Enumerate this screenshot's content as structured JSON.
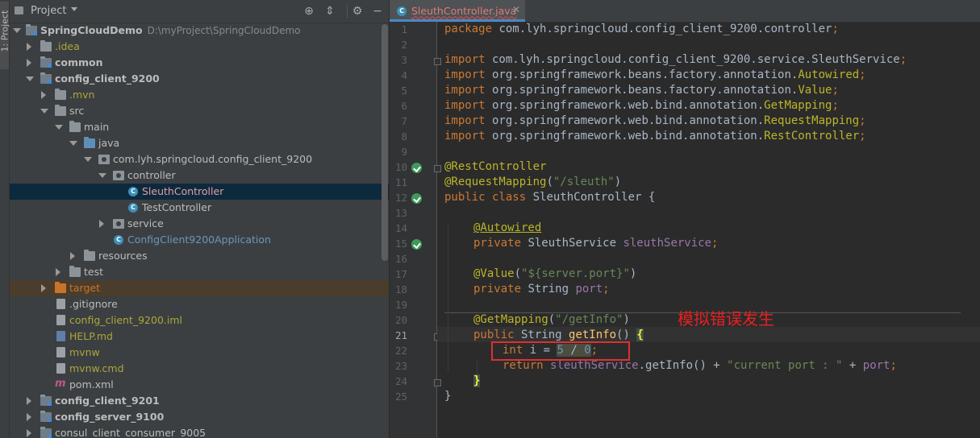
{
  "sidebar_stripe": {
    "label": "1: Project"
  },
  "project_panel": {
    "title": "Project",
    "tree": [
      {
        "label": "SpringCloudDemo",
        "path": "D:\\myProject\\SpringCloudDemo"
      },
      {
        "label": ".idea"
      },
      {
        "label": "common"
      },
      {
        "label": "config_client_9200"
      },
      {
        "label": ".mvn"
      },
      {
        "label": "src"
      },
      {
        "label": "main"
      },
      {
        "label": "java"
      },
      {
        "label": "com.lyh.springcloud.config_client_9200"
      },
      {
        "label": "controller"
      },
      {
        "label": "SleuthController"
      },
      {
        "label": "TestController"
      },
      {
        "label": "service"
      },
      {
        "label": "ConfigClient9200Application"
      },
      {
        "label": "resources"
      },
      {
        "label": "test"
      },
      {
        "label": "target"
      },
      {
        "label": ".gitignore"
      },
      {
        "label": "config_client_9200.iml"
      },
      {
        "label": "HELP.md"
      },
      {
        "label": "mvnw"
      },
      {
        "label": "mvnw.cmd"
      },
      {
        "label": "pom.xml"
      },
      {
        "label": "config_client_9201"
      },
      {
        "label": "config_server_9100"
      },
      {
        "label": "consul_client_consumer_9005"
      }
    ]
  },
  "editor": {
    "tab": {
      "label": "SleuthController.java",
      "icon_letter": "C"
    },
    "line_numbers": [
      "1",
      "2",
      "3",
      "4",
      "5",
      "6",
      "7",
      "8",
      "9",
      "10",
      "11",
      "12",
      "13",
      "14",
      "15",
      "16",
      "17",
      "18",
      "19",
      "20",
      "21",
      "22",
      "23",
      "24",
      "25"
    ],
    "tokens": {
      "l1": [
        "package",
        " com.lyh.springcloud.config_client_9200.controller",
        ";"
      ],
      "l3": [
        "import",
        " com.lyh.springcloud.config_client_9200.service.SleuthService",
        ";"
      ],
      "l4": [
        "import",
        " org.springframework.beans.factory.annotation.",
        "Autowired",
        ";"
      ],
      "l5": [
        "import",
        " org.springframework.beans.factory.annotation.",
        "Value",
        ";"
      ],
      "l6": [
        "import",
        " org.springframework.web.bind.annotation.",
        "GetMapping",
        ";"
      ],
      "l7": [
        "import",
        " org.springframework.web.bind.annotation.",
        "RequestMapping",
        ";"
      ],
      "l8": [
        "import",
        " org.springframework.web.bind.annotation.",
        "RestController",
        ";"
      ],
      "l10": [
        "@RestController"
      ],
      "l11": [
        "@RequestMapping",
        "(",
        "\"/sleuth\"",
        ")"
      ],
      "l12": [
        "public class",
        " SleuthController {"
      ],
      "l14": [
        "@Autowired"
      ],
      "l15": [
        "private",
        " SleuthService ",
        "sleuthService",
        ";"
      ],
      "l17": [
        "@Value",
        "(",
        "\"${server.port}\"",
        ")"
      ],
      "l18": [
        "private",
        " String ",
        "port",
        ";"
      ],
      "l20": [
        "@GetMapping",
        "(",
        "\"/getInfo\"",
        ")"
      ],
      "l21": [
        "public",
        " String ",
        "getInfo",
        "() ",
        "{"
      ],
      "l22": [
        "int",
        " i = ",
        "5",
        " / ",
        "0",
        ";"
      ],
      "l23": [
        "return",
        " ",
        "sleuthService",
        ".getInfo() + ",
        "\"current port : \"",
        " + ",
        "port",
        ";"
      ],
      "l24": [
        "}"
      ],
      "l25": [
        "}"
      ]
    },
    "annotation_note": "模拟错误发生"
  },
  "colors": {
    "keyword": "#cc7832",
    "annotation": "#bbb529",
    "string": "#6a8759",
    "field": "#9876aa",
    "number": "#6897bb",
    "method": "#ffc66d",
    "error_box": "#e03030"
  }
}
